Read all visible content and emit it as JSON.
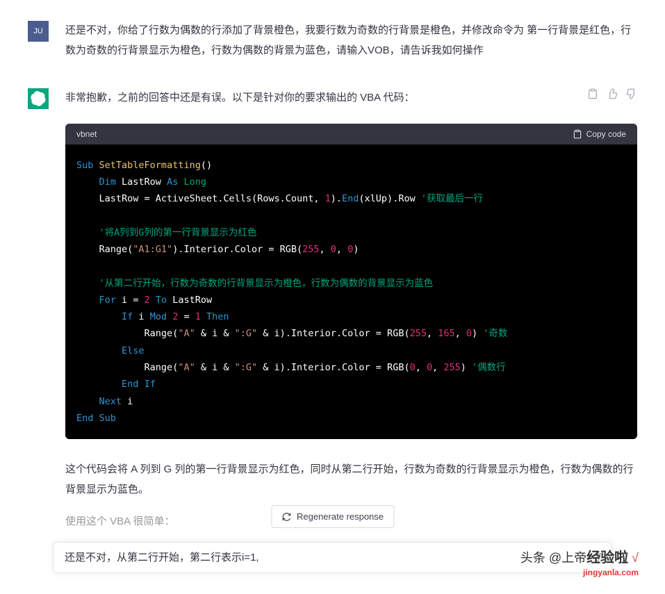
{
  "user": {
    "avatar_label": "JU",
    "message": "还是不对，你给了行数为偶数的行添加了背景橙色，我要行数为奇数的行背景是橙色，并修改命令为 第一行背景是红色，行数为奇数的行背景显示为橙色，行数为偶数的背景为蓝色，请输入VOB，请告诉我如何操作"
  },
  "ai": {
    "intro": "非常抱歉，之前的回答中还是有误。以下是针对你的要求输出的 VBA 代码：",
    "code_lang": "vbnet",
    "copy_label": "Copy code",
    "code": {
      "l1": {
        "a": "Sub",
        "b": " ",
        "c": "SetTableFormatting",
        "d": "()"
      },
      "l2": {
        "a": "    ",
        "b": "Dim",
        "c": " LastRow ",
        "d": "As",
        "e": " ",
        "f": "Long"
      },
      "l3": {
        "a": "    LastRow = ActiveSheet.Cells(Rows.Count, ",
        "b": "1",
        "c": ").",
        "d": "End",
        "e": "(xlUp).Row ",
        "f": "'获取最后一行"
      },
      "l4": " ",
      "l5": "    '将A列到G列的第一行背景显示为红色",
      "l6": {
        "a": "    Range(",
        "b": "\"A1:G1\"",
        "c": ").Interior.Color = RGB(",
        "d": "255",
        "e": ", ",
        "f": "0",
        "g": ", ",
        "h": "0",
        "i": ")"
      },
      "l7": " ",
      "l8": "    '从第二行开始，行数为奇数的行背景显示为橙色，行数为偶数的背景显示为蓝色",
      "l9": {
        "a": "    ",
        "b": "For",
        "c": " i = ",
        "d": "2",
        "e": " ",
        "f": "To",
        "g": " LastRow"
      },
      "l10": {
        "a": "        ",
        "b": "If",
        "c": " i ",
        "d": "Mod",
        "e": " ",
        "f": "2",
        "g": " = ",
        "h": "1",
        "i": " ",
        "j": "Then"
      },
      "l11": {
        "a": "            Range(",
        "b": "\"A\"",
        "c": " & i & ",
        "d": "\":G\"",
        "e": " & i).Interior.Color = RGB(",
        "f": "255",
        "g": ", ",
        "h": "165",
        "i": ", ",
        "j": "0",
        "k": ") ",
        "l": "'奇数"
      },
      "l12": {
        "a": "        ",
        "b": "Else"
      },
      "l13": {
        "a": "            Range(",
        "b": "\"A\"",
        "c": " & i & ",
        "d": "\":G\"",
        "e": " & i).Interior.Color = RGB(",
        "f": "0",
        "g": ", ",
        "h": "0",
        "i": ", ",
        "j": "255",
        "k": ") ",
        "l": "'偶数行"
      },
      "l14": {
        "a": "        ",
        "b": "End",
        "c": " ",
        "d": "If"
      },
      "l15": {
        "a": "    ",
        "b": "Next",
        "c": " i"
      },
      "l16": {
        "a": "End",
        "b": " ",
        "c": "Sub"
      }
    },
    "desc1": "这个代码会将 A 列到 G 列的第一行背景显示为红色，同时从第二行开始，行数为奇数的行背景显示为橙色，行数为偶数的行背景显示为蓝色。",
    "desc2": "使用这个 VBA 很简单："
  },
  "regen_label": "Regenerate response",
  "input_value": "还是不对，从第二行开始，第二行表示i=1,",
  "watermark": {
    "top1": "头条 @上帝",
    "top2": "经验啦",
    "sub": "jingyanla.com"
  }
}
